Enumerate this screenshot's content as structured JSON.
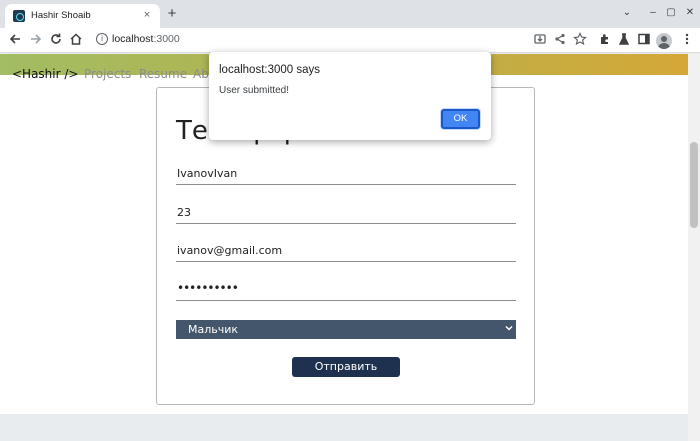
{
  "browser": {
    "tab_title": "Hashir Shoaib",
    "tab_close": "×",
    "new_tab": "+",
    "url_host": "localhost",
    "url_port": ":3000",
    "window_controls": [
      "⌄",
      "–",
      "▢",
      "✕"
    ],
    "icons": [
      "back-arrow-icon",
      "forward-arrow-icon",
      "reload-icon",
      "home-icon",
      "info-icon",
      "install-icon",
      "share-icon",
      "star-icon",
      "extensions-icon",
      "lab-icon",
      "sidepanel-icon",
      "profile-icon",
      "menu-icon"
    ]
  },
  "site": {
    "brand": "<Hashir />",
    "nav": [
      "Projects",
      "Resume",
      "Ab"
    ],
    "nav_colors": {
      "gradient_start": "#a2bd63",
      "gradient_end": "#d4a838"
    }
  },
  "form": {
    "title": "Тест форма",
    "fields": [
      {
        "name": "name",
        "value": "IvanovIvan"
      },
      {
        "name": "age",
        "value": "23"
      },
      {
        "name": "email",
        "value": "ivanov@gmail.com"
      },
      {
        "name": "password",
        "value": "••••••••••"
      }
    ],
    "select_value": "Мальчик",
    "submit_label": "Отправить"
  },
  "alert": {
    "title": "localhost:3000 says",
    "message": "User submitted!",
    "ok_label": "OK",
    "accent": "#4285f4"
  }
}
